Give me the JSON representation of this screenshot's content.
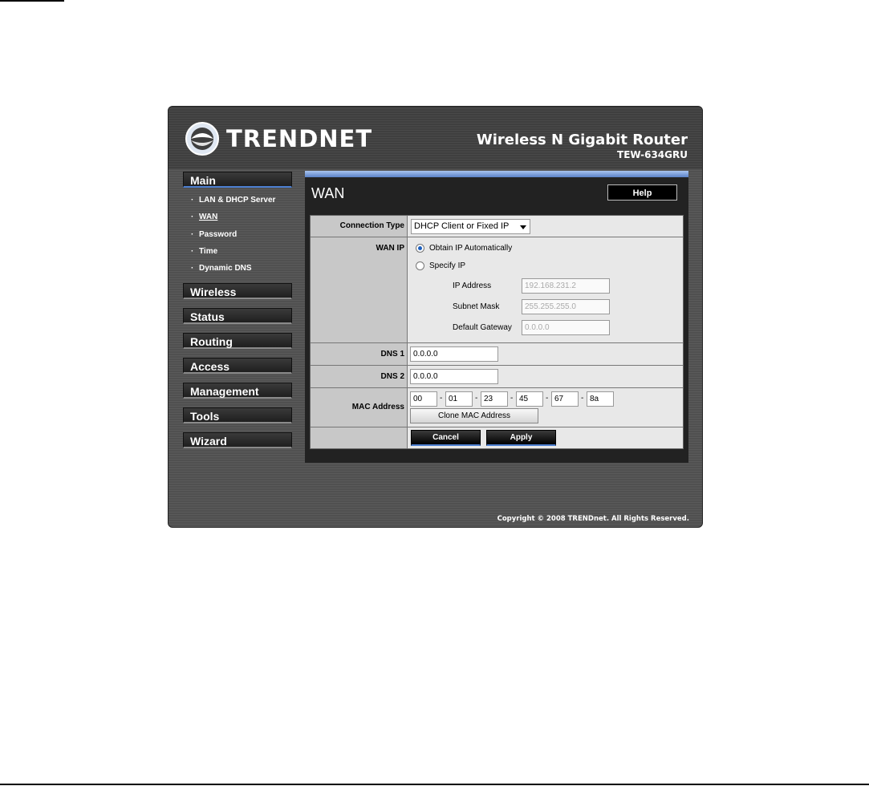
{
  "brand": {
    "logo_text": "TRENDNET",
    "product_title": "Wireless N Gigabit Router",
    "product_model": "TEW-634GRU"
  },
  "nav": {
    "main": "Main",
    "submenu": [
      {
        "label": "LAN & DHCP Server"
      },
      {
        "label": "WAN"
      },
      {
        "label": "Password"
      },
      {
        "label": "Time"
      },
      {
        "label": "Dynamic DNS"
      }
    ],
    "sections": [
      "Wireless",
      "Status",
      "Routing",
      "Access",
      "Management",
      "Tools",
      "Wizard"
    ]
  },
  "page": {
    "title": "WAN",
    "help_label": "Help"
  },
  "form": {
    "connection_type_label": "Connection Type",
    "connection_type_value": "DHCP Client or Fixed IP",
    "wan_ip_label": "WAN IP",
    "obtain_auto_label": "Obtain IP Automatically",
    "specify_ip_label": "Specify IP",
    "ip_address_label": "IP Address",
    "ip_address_value": "192.168.231.2",
    "subnet_mask_label": "Subnet Mask",
    "subnet_mask_value": "255.255.255.0",
    "gateway_label": "Default Gateway",
    "gateway_value": "0.0.0.0",
    "dns1_label": "DNS 1",
    "dns1_value": "0.0.0.0",
    "dns2_label": "DNS 2",
    "dns2_value": "0.0.0.0",
    "mac_label": "MAC Address",
    "mac_octets": [
      "00",
      "01",
      "23",
      "45",
      "67",
      "8a"
    ],
    "mac_separator": "-",
    "clone_mac_label": "Clone MAC Address",
    "cancel_label": "Cancel",
    "apply_label": "Apply"
  },
  "footer": {
    "copyright": "Copyright © 2008 TRENDnet. All Rights Reserved."
  },
  "colors": {
    "accent": "#4d7fd1",
    "panel_bar": "#7fa3df",
    "background": "#505050"
  }
}
